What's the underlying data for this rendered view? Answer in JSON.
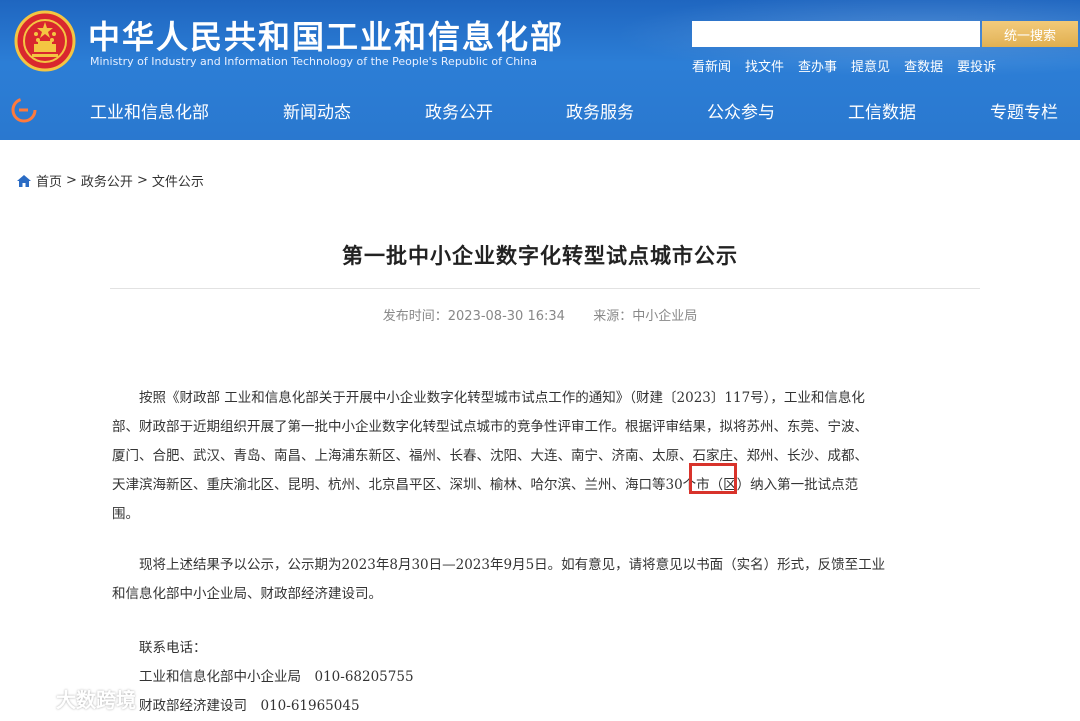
{
  "header": {
    "title_cn": "中华人民共和国工业和信息化部",
    "title_en": "Ministry of Industry and Information Technology of the People's Republic of China",
    "search": {
      "placeholder": "",
      "button_label": "统一搜索"
    },
    "quick_links": [
      "看新闻",
      "找文件",
      "查办事",
      "提意见",
      "查数据",
      "要投诉"
    ],
    "nav": [
      "工业和信息化部",
      "新闻动态",
      "政务公开",
      "政务服务",
      "公众参与",
      "工信数据",
      "专题专栏"
    ],
    "colors": {
      "banner": "#2a78cf",
      "search_button": "#e3ae4a"
    }
  },
  "breadcrumb": {
    "icon": "home-icon",
    "items": [
      "首页",
      "政务公开",
      "文件公示"
    ],
    "separator": ">"
  },
  "article": {
    "title": "第一批中小企业数字化转型试点城市公示",
    "meta_label_time": "发布时间：",
    "publish_time": "2023-08-30 16:34",
    "meta_label_source": "来源：",
    "source": "中小企业局",
    "paragraph1": [
      "　　按照《财政部 工业和信息化部关于开展中小企业数字化转型城市试点工作的通知》（财建〔2023〕117号），工业和信息化",
      "部、财政部于近期组织开展了第一批中小企业数字化转型试点城市的竞争性评审工作。根据评审结果，拟将苏州、东莞、宁波、",
      "厦门、合肥、武汉、青岛、南昌、上海浦东新区、福州、长春、沈阳、大连、南宁、济南、太原、石家庄、郑州、长沙、成都、",
      "天津滨海新区、重庆渝北区、昆明、杭州、北京昌平区、深圳、榆林、哈尔滨、兰州、海口等30个市（区）纳入第一批试点范",
      "围。"
    ],
    "paragraph2": [
      "　　现将上述结果予以公示，公示期为2023年8月30日—2023年9月5日。如有意见，请将意见以书面（实名）形式，反馈至工业",
      "和信息化部中小企业局、财政部经济建设司。"
    ],
    "contacts_label": "　　联系电话：",
    "contacts": [
      {
        "org": "工业和信息化部中小企业局",
        "phone": "010-68205755"
      },
      {
        "org": "财政部经济建设司",
        "phone": "010-61965045"
      }
    ],
    "highlight_color": "#d8332b"
  },
  "watermark": {
    "text": "大数跨境"
  }
}
